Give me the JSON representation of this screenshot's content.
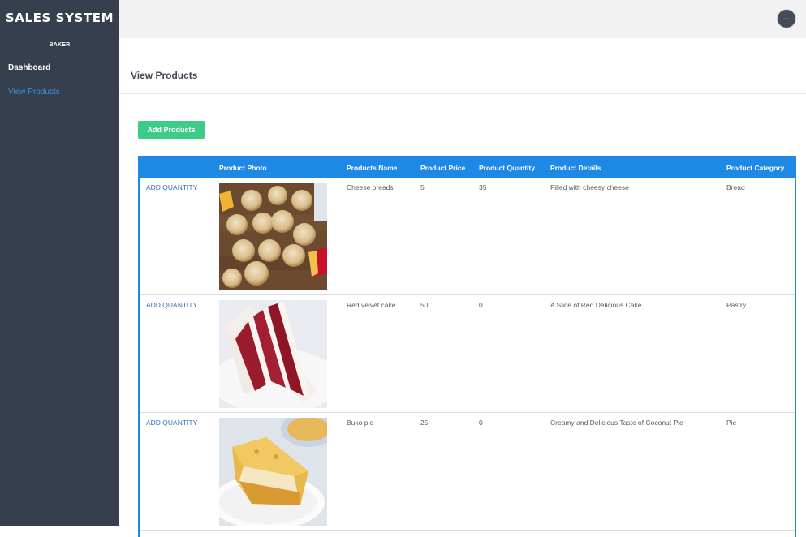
{
  "app": {
    "brand": "SALES SYSTEM",
    "role": "BAKER"
  },
  "sidebar": {
    "items": [
      {
        "label": "Dashboard"
      },
      {
        "label": "View Products"
      }
    ]
  },
  "page": {
    "title": "View Products"
  },
  "toolbar": {
    "add_label": "Add Products"
  },
  "table": {
    "columns": [
      "",
      "Product Photo",
      "Products Name",
      "Product Price",
      "Product Quantity",
      "Product Details",
      "Product Category"
    ],
    "rows": [
      {
        "action": "ADD QUANTITY",
        "photo": "cheese-breads-photo",
        "name": "Cheese breads",
        "price": "5",
        "quantity": "35",
        "details": "Filled with cheesy cheese",
        "category": "Bread"
      },
      {
        "action": "ADD QUANTITY",
        "photo": "red-velvet-cake-photo",
        "name": "Red velvet cake",
        "price": "50",
        "quantity": "0",
        "details": "A Slice of Red Delicious Cake",
        "category": "Pastry"
      },
      {
        "action": "ADD QUANTITY",
        "photo": "buko-pie-photo",
        "name": "Buko pie",
        "price": "25",
        "quantity": "0",
        "details": "Creamy and Delicious Taste of Coconut Pie",
        "category": "Pie"
      }
    ]
  },
  "colors": {
    "sidebar_bg": "#363f4d",
    "header_blue": "#1e88e5",
    "button_green": "#3dcb8a",
    "link_blue": "#3570b8"
  }
}
